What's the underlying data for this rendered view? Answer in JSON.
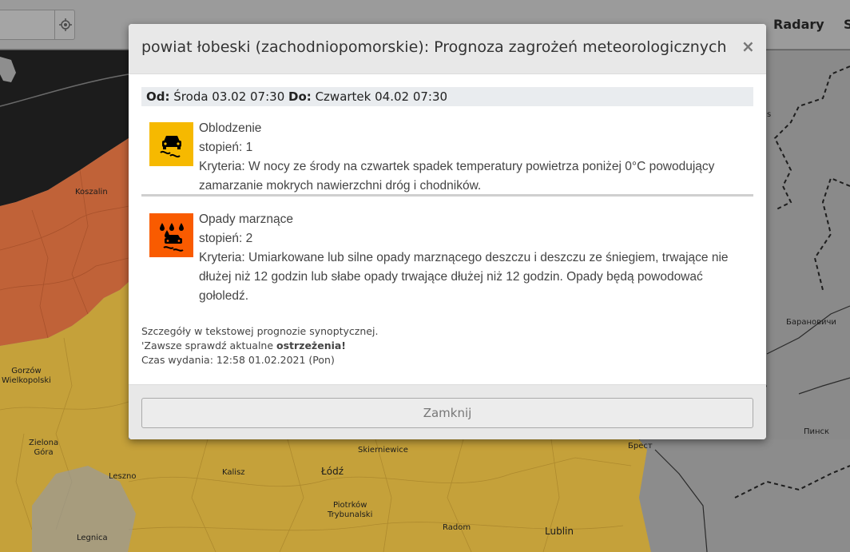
{
  "header": {
    "nav": [
      "Radary",
      "S"
    ]
  },
  "map": {
    "labels": {
      "koszalin": "Koszalin",
      "gorzow": "Gorzów\nWielkopolski",
      "zielona_gora": "Zielona\nGóra",
      "leszno": "Leszno",
      "legnica": "Legnica",
      "kalisz": "Kalisz",
      "skierniewice": "Skierniewice",
      "lodz": "Łódź",
      "piotrkow": "Piotrków\nTrybunalski",
      "radom": "Radom",
      "lublin": "Lublin",
      "brest": "Брест",
      "pinsk": "Пинск",
      "baranovichi": "Барановичи",
      "s_frag": "s"
    },
    "colors": {
      "sea": "#1c1c1c",
      "level2": "#c06238",
      "level1": "#c5a13a",
      "land": "#8e8e8e"
    }
  },
  "modal": {
    "title": "powiat łobeski (zachodniopomorskie): Prognoza zagrożeń meteorologicznych",
    "close_symbol": "×",
    "date_range": {
      "from_label": "Od:",
      "from_value": "Środa 03.02 07:30",
      "to_label": "Do:",
      "to_value": "Czwartek 04.02 07:30"
    },
    "warnings": [
      {
        "icon": "slippery-road-icon",
        "icon_color": "#f6b900",
        "name": "Oblodzenie",
        "level": "stopień: 1",
        "criteria": "Kryteria: W nocy ze środy na czwartek spadek temperatury powietrza poniżej 0°C powodujący zamarzanie mokrych nawierzchni dróg i chodników."
      },
      {
        "icon": "freezing-rain-icon",
        "icon_color": "#f95b00",
        "name": "Opady marznące",
        "level": "stopień: 2",
        "criteria": "Kryteria: Umiarkowane lub silne opady marznącego deszczu i deszczu ze śniegiem, trwające nie dłużej niż 12 godzin lub słabe opady trwające dłużej niż 12 godzin. Opady będą powodować gołoledź."
      }
    ],
    "notes": {
      "line1": "Szczegóły w tekstowej prognozie synoptycznej.",
      "line2_prefix": "'Zawsze sprawdź aktualne ",
      "line2_bold": "ostrzeżenia!",
      "line3": "Czas wydania: 12:58 01.02.2021 (Pon)"
    },
    "close_button": "Zamknij"
  }
}
